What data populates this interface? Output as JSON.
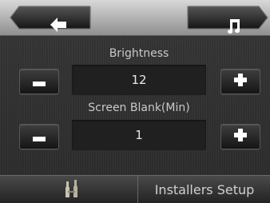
{
  "nav": {
    "back_icon": "left-arrow-icon",
    "music_icon": "music-note-icon"
  },
  "brightness": {
    "label": "Brightness",
    "value": "12"
  },
  "screen_blank": {
    "label": "Screen Blank(Min)",
    "value": "1"
  },
  "bottom": {
    "tools_icon": "tools-icon",
    "installers_label": "Installers Setup"
  },
  "colors": {
    "top_bar": "#b7b7b7",
    "panel": "#2f2f2f",
    "value_box": "#202020",
    "button": "#2a2a2a",
    "icon_white": "#ffffff",
    "accent_tab": "#c8c8c8"
  }
}
